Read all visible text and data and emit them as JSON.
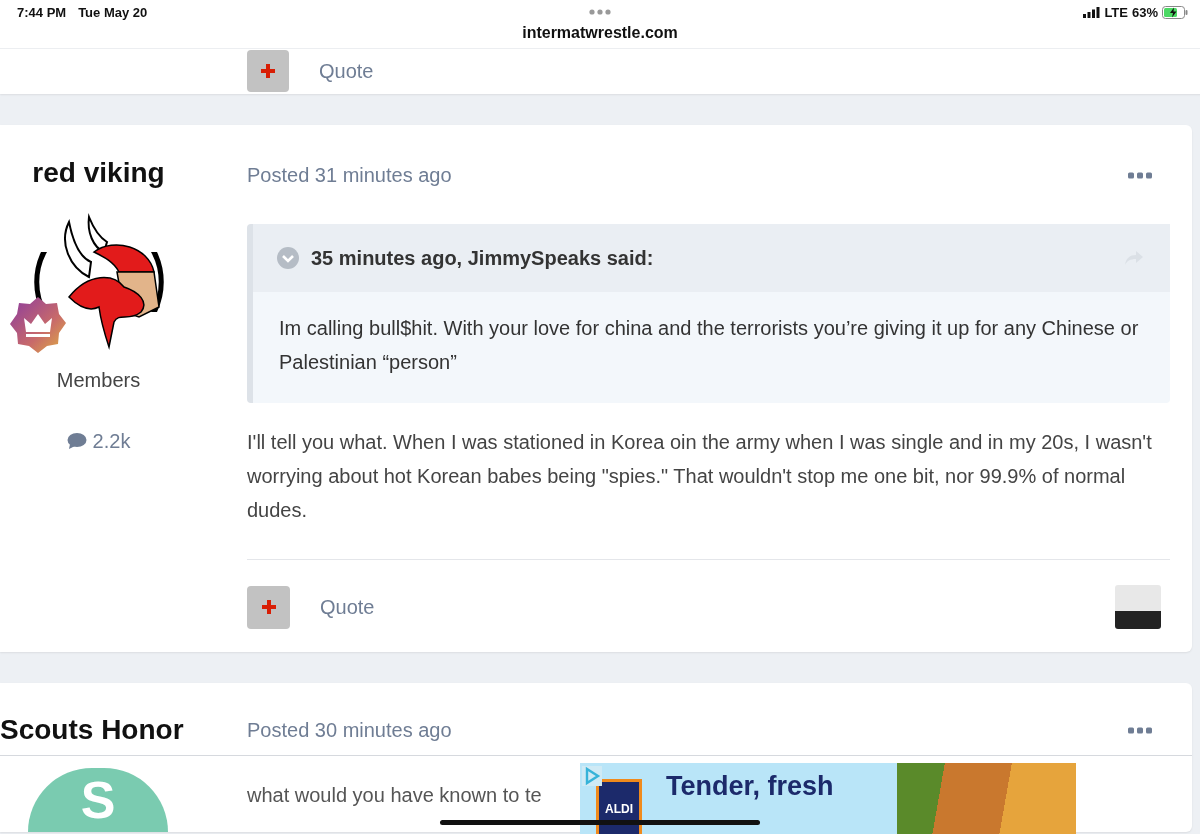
{
  "status_bar": {
    "time": "7:44 PM",
    "date": "Tue May 20",
    "url": "intermatwrestle.com",
    "network": "LTE",
    "battery": "63%"
  },
  "posts": [
    {
      "kind": "fragment",
      "quote_label": "Quote"
    },
    {
      "kind": "full",
      "author": "red viking",
      "avatar": {
        "kind": "logo"
      },
      "group": "Members",
      "post_count": "2.2k",
      "posted": "Posted 31 minutes ago",
      "quote": {
        "header": "35 minutes ago, JimmySpeaks said:",
        "text": "Im calling bull$hit.  With your love for china and the terrorists you’re giving it up for any Chinese or Palestinian “person”"
      },
      "body": "I'll tell you what. When I was stationed in Korea oin the army when I was single and in my 20s, I wasn't worrying about hot Korean babes being \"spies.\" That wouldn't stop me one bit, nor 99.9% of normal dudes.",
      "quote_label": "Quote"
    },
    {
      "kind": "partial",
      "author": "Scouts Honor",
      "avatar": {
        "kind": "letter",
        "letter": "S"
      },
      "posted": "Posted 30 minutes ago",
      "body": "what would you have known to te"
    }
  ],
  "ad": {
    "headline": "Tender, fresh",
    "brand": "ALDI"
  }
}
